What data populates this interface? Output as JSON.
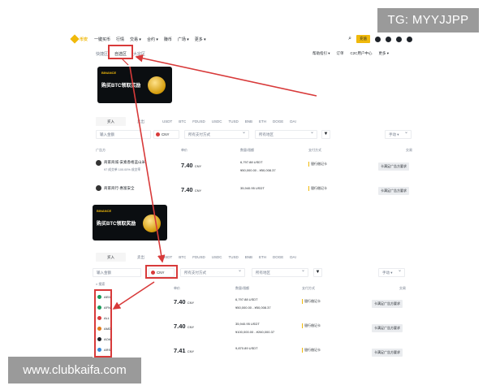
{
  "watermarks": {
    "top_right": "TG: MYYJJPP",
    "bottom_left": "www.clubkaifa.com"
  },
  "topnav": {
    "logo": "币安",
    "items": [
      "一键买币",
      "行情",
      "交易 ▾",
      "合约 ▾",
      "赚币",
      "广场 ▾",
      "更多 ▾"
    ],
    "right_button": "充值"
  },
  "subtabs": [
    "快捷区",
    "自选区",
    "大宗区"
  ],
  "subright": [
    "帮助指引 ▾",
    "订单",
    "C2C用户中心",
    "更多 ▾"
  ],
  "banner": {
    "brand": "BINANCE",
    "title": "购买BTC领取奖励"
  },
  "crypto_tabs": {
    "buy": "买入",
    "sell": "卖出",
    "coins": [
      "USDT",
      "BTC",
      "FDUSD",
      "USDC",
      "TUSD",
      "BNB",
      "ETH",
      "DOGE",
      "DAI"
    ]
  },
  "filters": {
    "amount_placeholder": "输入金额",
    "currency": "CNY",
    "payment": "所有支付方式",
    "region": "所有地区",
    "refresh": "手动 ▾"
  },
  "table_headers": [
    "广告方",
    "单价",
    "数量/限额",
    "支付方式",
    "交易"
  ],
  "rows_top": [
    {
      "name": "商家商城-安素香格蓝山米",
      "stats": "97 成交单  100.00% 成交率",
      "price": "7.40",
      "unit": "CNY",
      "avail": "6,797.88 USDT",
      "limit": "¥50,000.00 - ¥50,008.37",
      "pay": "银行借记卡",
      "action": "卡满足广告方要求"
    },
    {
      "name": "商家商行-惠富安全",
      "stats": "",
      "price": "7.40",
      "unit": "CNY",
      "avail": "35,940.95 USDT",
      "limit": "",
      "pay": "银行借记卡",
      "action": "卡满足广告方要求"
    }
  ],
  "rows_bottom": [
    {
      "price": "7.40",
      "unit": "CNY",
      "avail": "6,797.88 USDT",
      "limit": "¥50,000.00 - ¥50,008.37",
      "pay": "银行借记卡",
      "action": "卡满足广告方要求"
    },
    {
      "price": "7.40",
      "unit": "CNY",
      "avail": "35,940.95 USDT",
      "limit": "¥100,000.00 - ¥260,000.37",
      "pay": "银行借记卡",
      "action": "卡满足广告方要求"
    },
    {
      "price": "7.41",
      "unit": "CNY",
      "avail": "9,870.89 USDT",
      "limit": "",
      "pay": "银行借记卡",
      "action": "卡满足广告方要求"
    }
  ],
  "currency_dropdown": {
    "search_placeholder": "搜索",
    "items": [
      {
        "code": "AED",
        "color": "#1a9a5a"
      },
      {
        "code": "AFN",
        "color": "#1a9a5a"
      },
      {
        "code": "ALL",
        "color": "#d83a3a"
      },
      {
        "code": "AMD",
        "color": "#e07a1a"
      },
      {
        "code": "AOA",
        "color": "#1e2329"
      },
      {
        "code": "ARS",
        "color": "#3a8ad8"
      }
    ]
  },
  "colors": {
    "accent": "#f0b90b",
    "highlight": "#d83a3a",
    "text": "#1e2329",
    "muted": "#707a8a"
  }
}
